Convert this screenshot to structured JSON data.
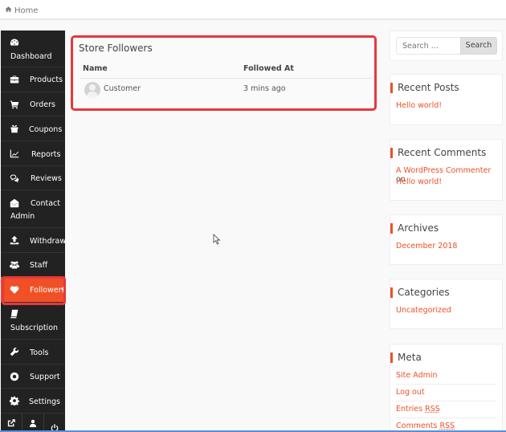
{
  "breadcrumb": {
    "home_label": "Home",
    "icon": "home-icon"
  },
  "sidebar": {
    "items": [
      {
        "label": "Dashboard",
        "icon": "dashboard-icon"
      },
      {
        "label": "Products",
        "icon": "briefcase-icon"
      },
      {
        "label": "Orders",
        "icon": "cart-icon"
      },
      {
        "label": "Coupons",
        "icon": "gift-icon"
      },
      {
        "label": "Reports",
        "icon": "line-chart-icon"
      },
      {
        "label": "Reviews",
        "icon": "comments-icon"
      },
      {
        "label_line1": "Contact",
        "label_line2": "Admin",
        "icon": "envelope-open-icon"
      },
      {
        "label": "Withdraw",
        "icon": "upload-icon"
      },
      {
        "label": "Staff",
        "icon": "users-icon"
      },
      {
        "label": "Followers",
        "icon": "heart-icon",
        "active": true
      },
      {
        "label": "Subscription",
        "icon": "book-icon"
      },
      {
        "label": "Tools",
        "icon": "wrench-icon"
      },
      {
        "label": "Support",
        "icon": "lifebuoy-icon"
      },
      {
        "label": "Settings",
        "icon": "gear-icon"
      }
    ],
    "footer": [
      {
        "icon": "external-link-icon"
      },
      {
        "icon": "user-icon"
      },
      {
        "icon": "power-icon"
      }
    ],
    "active_color": "#f05025"
  },
  "main": {
    "title": "Store Followers",
    "columns": [
      "Name",
      "Followed At"
    ],
    "rows": [
      {
        "name": "Customer",
        "followed_at": "3 mins ago"
      }
    ],
    "highlight_color": "#e8373e"
  },
  "widgets": {
    "search": {
      "placeholder": "Search …",
      "button_label": "Search"
    },
    "recent_posts": {
      "title": "Recent Posts",
      "items": [
        "Hello world!"
      ]
    },
    "recent_comments": {
      "title": "Recent Comments",
      "author": "A WordPress Commenter",
      "connector": "on",
      "post": "Hello world!"
    },
    "archives": {
      "title": "Archives",
      "items": [
        "December 2018"
      ]
    },
    "categories": {
      "title": "Categories",
      "items": [
        "Uncategorized"
      ]
    },
    "meta": {
      "title": "Meta",
      "items": [
        {
          "text": "Site Admin"
        },
        {
          "text": "Log out"
        },
        {
          "prefix": "Entries ",
          "abbr": "RSS"
        },
        {
          "prefix": "Comments ",
          "abbr": "RSS"
        }
      ]
    },
    "link_color": "#f05025"
  }
}
